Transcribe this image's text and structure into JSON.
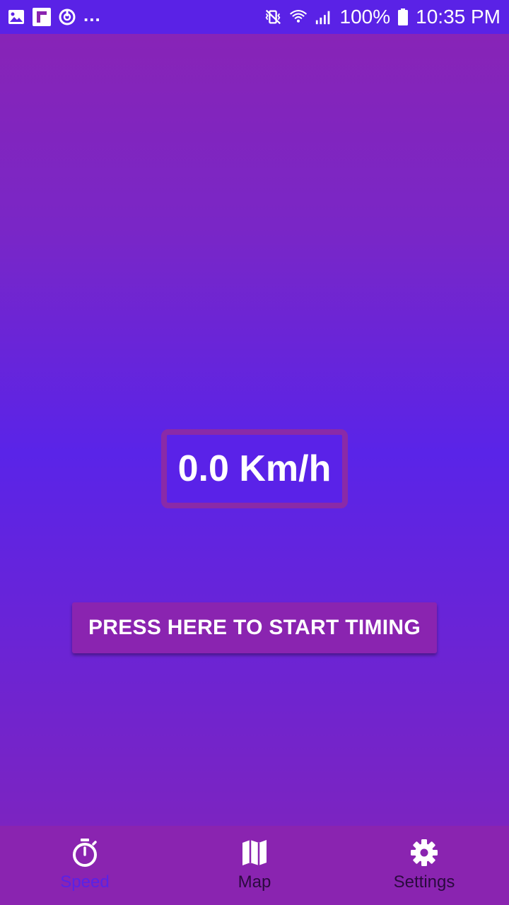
{
  "status_bar": {
    "notification_icons": [
      "gallery-icon",
      "flipboard-icon",
      "sync-icon"
    ],
    "more_notifications": "...",
    "system_icons": [
      "vibrate-mute-icon",
      "wifi-icon",
      "signal-icon"
    ],
    "battery_percent": "100%",
    "battery_icon": "battery-full-icon",
    "time": "10:35 PM"
  },
  "speed_display": {
    "value": "0.0 Km/h"
  },
  "start_button": {
    "label": "PRESS HERE TO START TIMING"
  },
  "bottom_nav": {
    "items": [
      {
        "label": "Speed",
        "icon": "stopwatch-icon",
        "active": true
      },
      {
        "label": "Map",
        "icon": "map-icon",
        "active": false
      },
      {
        "label": "Settings",
        "icon": "gear-icon",
        "active": false
      }
    ]
  },
  "colors": {
    "status_bar": "#5a22e6",
    "accent_purple": "#8a24b0",
    "active_nav": "#5a22e6",
    "text_white": "#ffffff"
  }
}
